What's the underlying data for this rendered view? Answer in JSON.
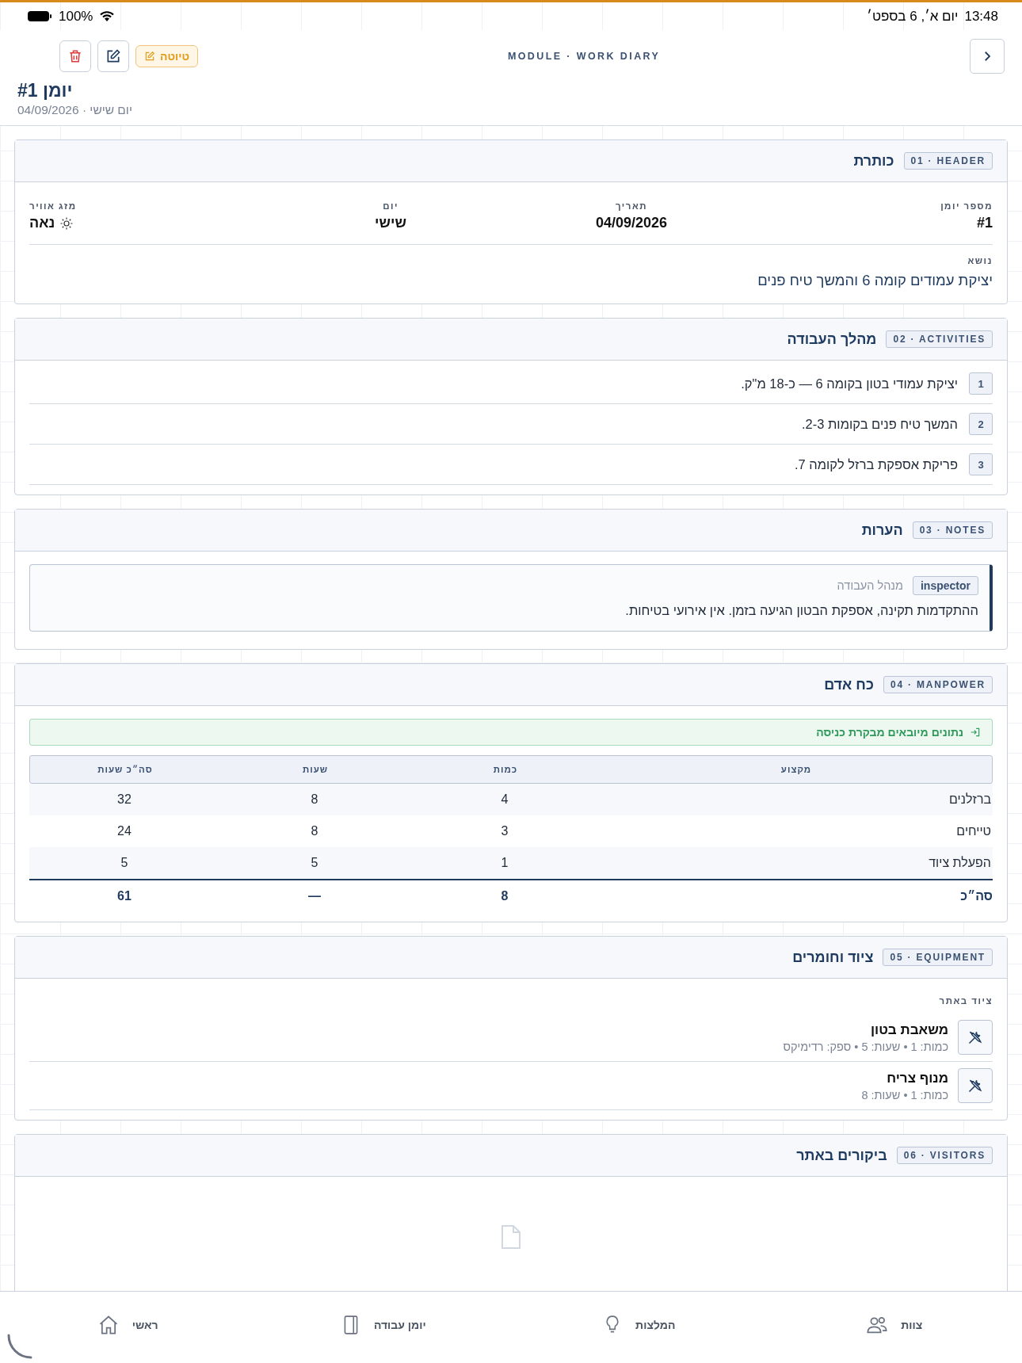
{
  "status_bar": {
    "time": "13:48",
    "date": "יום א׳, 6 בספט׳",
    "battery": "100%"
  },
  "top_bar": {
    "module": "MODULE · WORK DIARY",
    "status_badge": "טיוטה",
    "title": "יומן #1",
    "subtitle": "יום שישי · 04/09/2026"
  },
  "sections": [
    {
      "kind": "fields",
      "tag": "01 · HEADER",
      "title": "כותרת",
      "fields": [
        {
          "kind": "text",
          "label": "מספר יומן",
          "value": "#1"
        },
        {
          "kind": "text",
          "label": "תאריך",
          "value": "04/09/2026"
        },
        {
          "kind": "text",
          "label": "יום",
          "value": "שישי"
        },
        {
          "kind": "weather",
          "label": "מזג אוויר",
          "value": "נאה"
        }
      ],
      "subject": {
        "label": "נושא",
        "value": "יציקת עמודים קומה 6 והמשך טיח פנים"
      }
    },
    {
      "kind": "activities",
      "tag": "02 · ACTIVITIES",
      "title": "מהלך העבודה",
      "items": [
        {
          "number": "1",
          "text": "יציקת עמודי בטון בקומה 6 — כ-18 מ\"ק."
        },
        {
          "number": "2",
          "text": "המשך טיח פנים בקומות 2-3."
        },
        {
          "number": "3",
          "text": "פריקת אספקת ברזל לקומה 7."
        }
      ]
    },
    {
      "kind": "notes",
      "tag": "03 · NOTES",
      "title": "הערות",
      "notes": [
        {
          "role": "inspector",
          "author": "מנהל העבודה",
          "text": "ההתקדמות תקינה, אספקת הבטון הגיעה בזמן. אין אירועי בטיחות."
        }
      ]
    },
    {
      "kind": "manpower",
      "tag": "04 · MANPOWER",
      "title": "כח אדם",
      "banner": "נתונים מיובאים מבקרת כניסה",
      "columns": [
        "מקצוע",
        "כמות",
        "שעות",
        "סה״כ שעות"
      ],
      "rows": [
        [
          "ברזלנים",
          "4",
          "8",
          "32"
        ],
        [
          "טייחים",
          "3",
          "8",
          "24"
        ],
        [
          "הפעלת ציוד",
          "1",
          "5",
          "5"
        ]
      ],
      "total": [
        "סה״כ",
        "8",
        "—",
        "61"
      ]
    },
    {
      "kind": "equipment",
      "tag": "05 · EQUIPMENT",
      "title": "ציוד וחומרים",
      "subheading": "ציוד באתר",
      "items": [
        {
          "name": "משאבת בטון",
          "meta": "כמות: 1 • שעות: 5 • ספק: רדימיקס"
        },
        {
          "name": "מנוף צריח",
          "meta": "כמות: 1 • שעות: 8"
        }
      ]
    },
    {
      "kind": "empty",
      "tag": "06 · VISITORS",
      "title": "ביקורים באתר"
    }
  ],
  "nav": [
    {
      "label": "צוות"
    },
    {
      "label": "המלצות"
    },
    {
      "label": "יומן עבודה"
    },
    {
      "label": "ראשי"
    }
  ]
}
